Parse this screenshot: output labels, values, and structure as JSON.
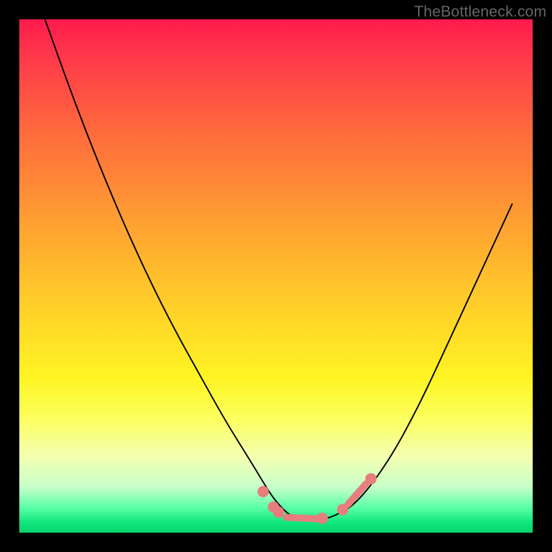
{
  "watermark": "TheBottleneck.com",
  "colors": {
    "frame_background_top": "#ff1a4d",
    "frame_background_bottom": "#08d46b",
    "curve": "#000000",
    "markers": "#e77d7d",
    "page_background": "#000000",
    "watermark_text": "#666666"
  },
  "chart_data": {
    "type": "line",
    "title": "",
    "xlabel": "",
    "ylabel": "",
    "xlim": [
      0,
      100
    ],
    "ylim": [
      0,
      100
    ],
    "grid": false,
    "legend": false,
    "note": "Axes are unlabeled in the source image; values are read as pixel-fraction percentages of the 744×744 plot area. y=0 is the bottom edge (green), y=100 is the top (red). The curve depicts a V-shaped bottleneck profile.",
    "series": [
      {
        "name": "bottleneck-curve",
        "x": [
          5,
          10,
          15,
          20,
          25,
          30,
          35,
          40,
          45,
          48,
          50,
          53,
          56,
          59,
          62,
          66,
          72,
          78,
          84,
          90,
          96
        ],
        "y": [
          100,
          86,
          73,
          61,
          50,
          40,
          31,
          22,
          14,
          9,
          6,
          3,
          2.5,
          2.5,
          3.5,
          6,
          14,
          25,
          38,
          51,
          64
        ]
      }
    ],
    "markers": [
      {
        "shape": "circle",
        "x": 47.5,
        "y": 8.0,
        "r": 1.1
      },
      {
        "shape": "circle",
        "x": 49.5,
        "y": 5.0,
        "r": 1.1
      },
      {
        "shape": "circle",
        "x": 50.5,
        "y": 4.0,
        "r": 1.1
      },
      {
        "shape": "bar",
        "x0": 52.0,
        "y0": 3.0,
        "x1": 58.0,
        "y1": 2.7
      },
      {
        "shape": "circle",
        "x": 59.0,
        "y": 2.8,
        "r": 1.1
      },
      {
        "shape": "circle",
        "x": 63.0,
        "y": 4.5,
        "r": 1.1
      },
      {
        "shape": "bar",
        "x0": 64.0,
        "y0": 5.5,
        "x1": 67.5,
        "y1": 9.5
      },
      {
        "shape": "circle",
        "x": 68.5,
        "y": 10.5,
        "r": 1.1
      }
    ]
  }
}
